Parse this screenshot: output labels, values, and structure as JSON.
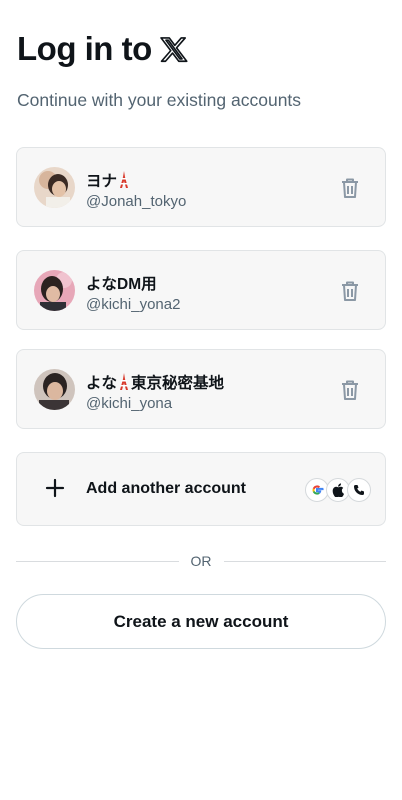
{
  "header": {
    "title": "Log in to",
    "brand_icon": "x-logo-icon",
    "subtitle": "Continue with your existing accounts"
  },
  "accounts": [
    {
      "name_parts": [
        "ヨナ",
        ""
      ],
      "has_tower_emoji": true,
      "handle": "@Jonah_tokyo",
      "avatar_colors": [
        "#c9a58a",
        "#3a2a24"
      ]
    },
    {
      "name_parts": [
        "よなDM用",
        ""
      ],
      "has_tower_emoji": false,
      "handle": "@kichi_yona2",
      "avatar_colors": [
        "#d98aa0",
        "#2b2220"
      ]
    },
    {
      "name_parts": [
        "よな",
        "東京秘密基地"
      ],
      "has_tower_emoji": true,
      "handle": "@kichi_yona",
      "avatar_colors": [
        "#b8a9a0",
        "#2a2322"
      ]
    }
  ],
  "add_account": {
    "label": "Add another account",
    "icons": [
      "plus-icon",
      "google-icon",
      "apple-icon",
      "phone-icon"
    ]
  },
  "divider": {
    "label": "OR"
  },
  "create": {
    "label": "Create a new account"
  },
  "colors": {
    "text_primary": "#0f1419",
    "text_secondary": "#536471",
    "card_bg": "#f7f7f7"
  }
}
